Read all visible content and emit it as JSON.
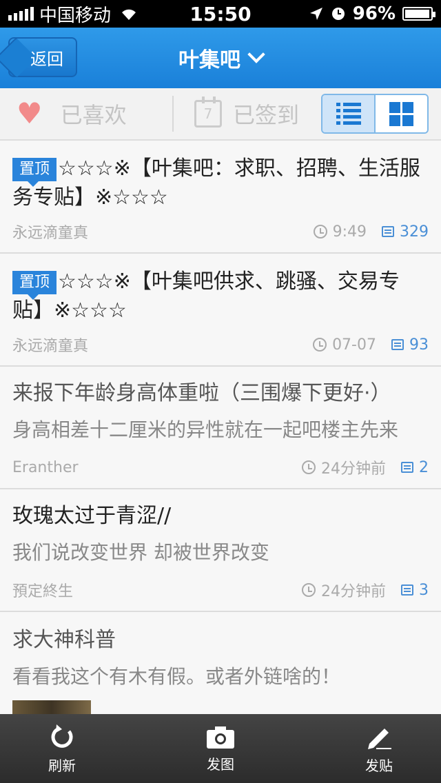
{
  "status": {
    "carrier": "中国移动",
    "time": "15:50",
    "battery": "96%",
    "battery_level": 0.96
  },
  "nav": {
    "back_label": "返回",
    "title": "叶集吧",
    "icons": [
      "chevron-down-icon"
    ]
  },
  "toolbar": {
    "liked_label": "已喜欢",
    "signed_label": "已签到",
    "calendar_day": "7",
    "view_mode": "list"
  },
  "posts": [
    {
      "pin_label": "置顶",
      "title": "☆☆☆※【叶集吧：求职、招聘、生活服务专贴】※☆☆☆",
      "author": "永远滴童真",
      "time": "9:49",
      "comments": "329"
    },
    {
      "pin_label": "置顶",
      "title": "☆☆☆※【叶集吧供求、跳骚、交易专贴】※☆☆☆",
      "author": "永远滴童真",
      "time": "07-07",
      "comments": "93"
    },
    {
      "title": "来报下年龄身高体重啦（三围爆下更好·）",
      "excerpt": "身高相差十二厘米的异性就在一起吧楼主先来",
      "author": "Eranther",
      "time": "24分钟前",
      "comments": "2"
    },
    {
      "title": "玫瑰太过于青涩//",
      "excerpt": "我们说改变世界 却被世界改变",
      "author": "預定終生",
      "time": "24分钟前",
      "comments": "3"
    },
    {
      "title": "求大神科普",
      "excerpt": "看看我这个有木有假。或者外链啥的！"
    }
  ],
  "tabbar": {
    "refresh_label": "刷新",
    "photo_label": "发图",
    "post_label": "发贴"
  },
  "colors": {
    "accent": "#1a80d9",
    "heart": "#f28a8a"
  }
}
